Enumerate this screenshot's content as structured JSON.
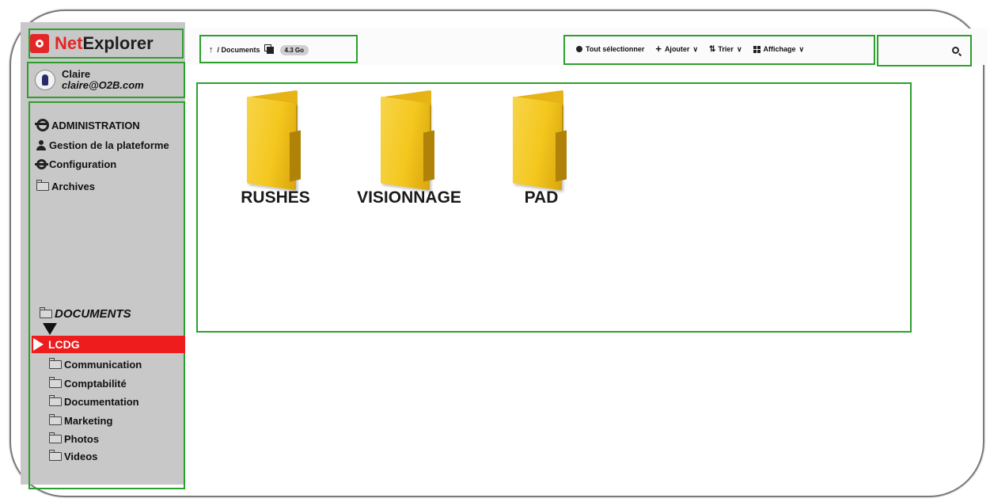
{
  "brand": {
    "net": "Net",
    "explorer": "Explorer"
  },
  "user": {
    "name": "Claire",
    "email": "claire@O2B.com"
  },
  "sidebar": {
    "admin": "ADMINISTRATION",
    "gestion": "Gestion de la plateforme",
    "configuration": "Configuration",
    "archives": "Archives",
    "documents": "DOCUMENTS",
    "selected": "LCDG",
    "subfolders": [
      "Communication",
      "Comptabilité",
      "Documentation",
      "Marketing",
      "Photos",
      "Videos"
    ]
  },
  "breadcrumb": {
    "path": "/ Documents",
    "size": "4.3 Go"
  },
  "toolbar": {
    "select_all": "Tout sélectionner",
    "add": "Ajouter",
    "sort": "Trier",
    "display": "Affichage"
  },
  "folders": [
    "RUSHES",
    "VISIONNAGE",
    "PAD"
  ],
  "colors": {
    "accent": "#ee1c1c",
    "highlight_box": "#2ca02c",
    "sidebar_bg": "#c8c8c8",
    "folder": "#f4c71e"
  }
}
